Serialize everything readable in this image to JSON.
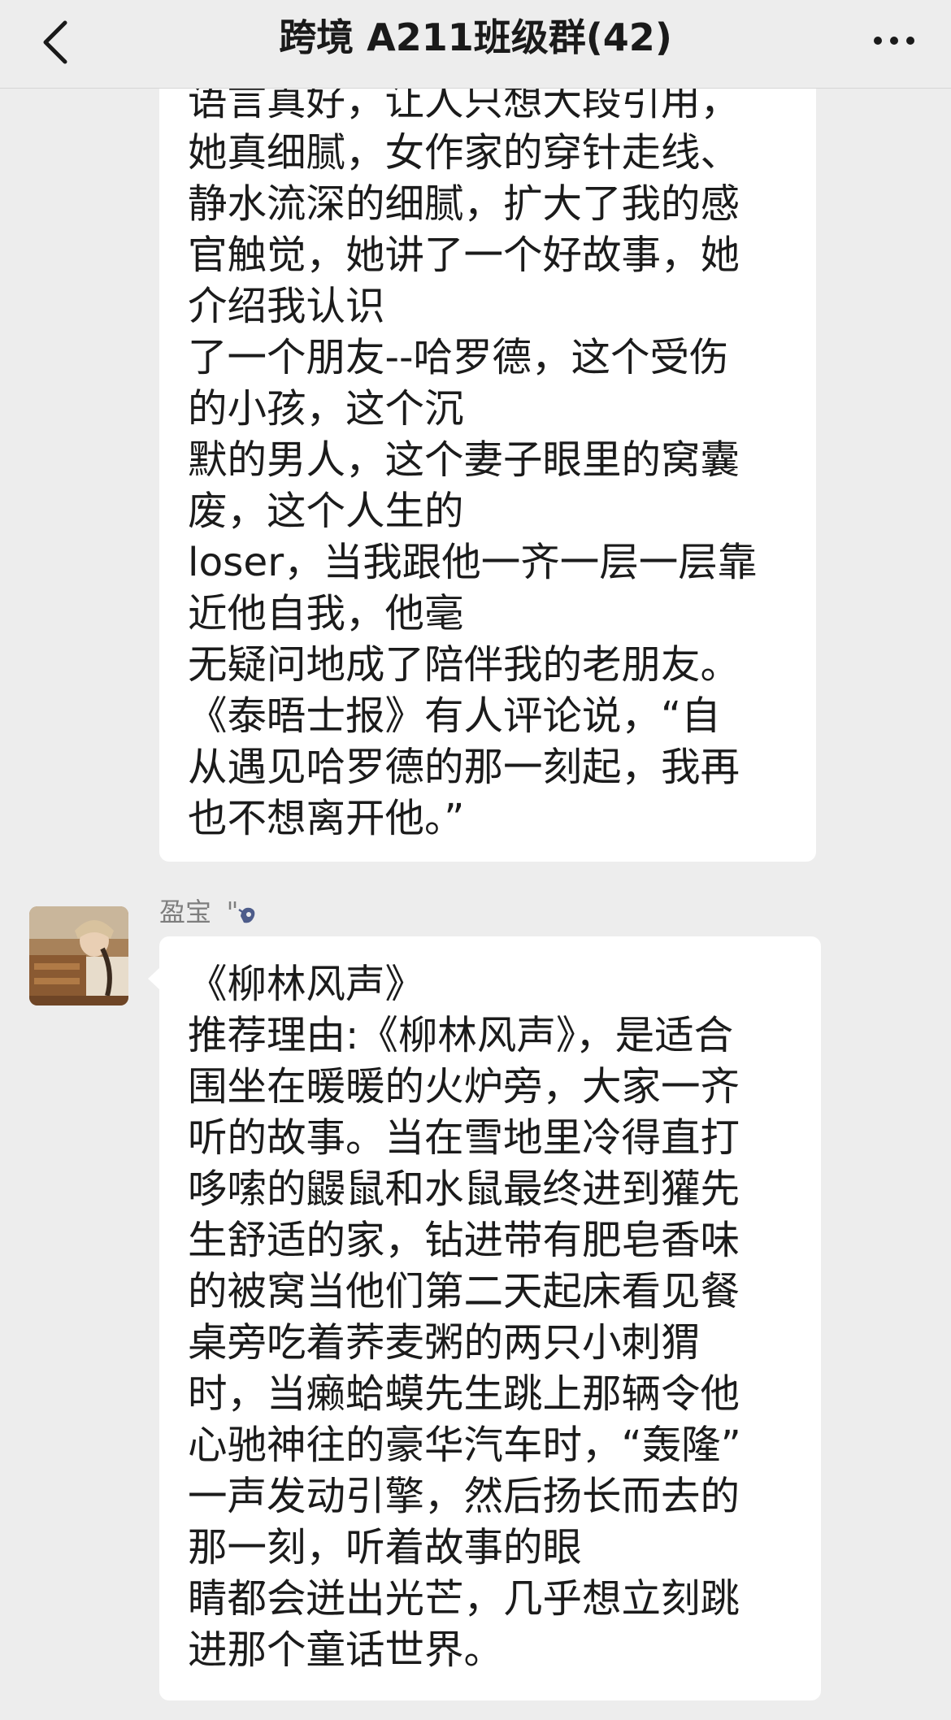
{
  "header": {
    "title": "跨境 A211班级群(42)"
  },
  "messages": [
    {
      "lines": [
        "语言真好，让人只想大段引用，",
        "她真细腻，女作家的穿针走线、",
        "静水流深的细腻，扩大了我的感",
        "官触觉，她讲了一个好故事，她",
        "介绍我认识",
        "了一个朋友--哈罗德，这个受伤",
        "的小孩，这个沉",
        "默的男人，这个妻子眼里的窝囊",
        "废，这个人生的",
        "loser，当我跟他一齐一层一层靠",
        "近他自我，他毫",
        "无疑问地成了陪伴我的老朋友。",
        "《泰晤士报》有人评论说，“自",
        "从遇见哈罗德的那一刻起，我再",
        "也不想离开他。”"
      ]
    },
    {
      "sender": "盈宝",
      "lines": [
        "《柳林风声》",
        "推荐理由:《柳林风声》，是适合",
        "围坐在暖暖的火炉旁，大家一齐",
        "听的故事。当在雪地里冷得直打",
        "哆嗦的鼹鼠和水鼠最终进到獾先",
        "生舒适的家，钻进带有肥皂香味",
        "的被窝当他们第二天起床看见餐",
        "桌旁吃着荞麦粥的两只小刺猬",
        "时，当癞蛤蟆先生跳上那辆令他",
        "心驰神往的豪华汽车时，“轰隆”",
        "一声发动引擎，然后扬长而去的",
        "那一刻，听着故事的眼",
        "睛都会迸出光芒，几乎想立刻跳",
        "进那个童话世界。"
      ]
    }
  ]
}
